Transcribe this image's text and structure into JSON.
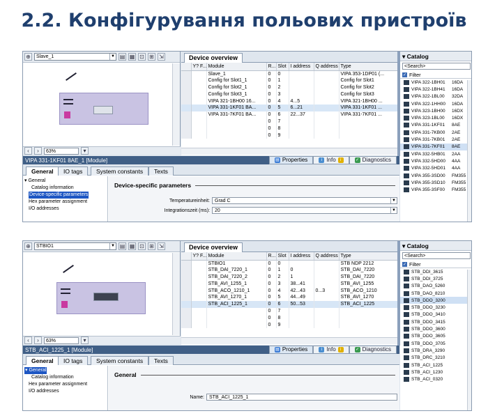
{
  "slide_title": "2.2. Конфігурування польових пристроїв",
  "panels": [
    {
      "device_combo": "Slave_1",
      "zoom": "63%",
      "overview_tab": "Device overview",
      "columns": [
        "",
        "Y? F...",
        "Module",
        "R...",
        "Slot",
        "I address",
        "Q address",
        "Type"
      ],
      "rows": [
        [
          "",
          "",
          "Slave_1",
          "0",
          "0",
          "",
          "",
          "VIPA 353-1DP01 (..."
        ],
        [
          "",
          "",
          "Config for Slot1_1",
          "0",
          "1",
          "",
          "",
          "Config for Slot1"
        ],
        [
          "",
          "",
          "Config for Slot2_1",
          "0",
          "2",
          "",
          "",
          "Config for Slot2"
        ],
        [
          "",
          "",
          "Config for Slot3_1",
          "0",
          "3",
          "",
          "",
          "Config for Slot3"
        ],
        [
          "",
          "",
          "VIPA 321-1BH00    16...",
          "0",
          "4",
          "4...5",
          "",
          "VIPA 321-1BH00 ..."
        ],
        [
          "",
          "",
          "VIPA 331-1KF01    BA...",
          "0",
          "5",
          "6...21",
          "",
          "VIPA 331-1KF01 ..."
        ],
        [
          "",
          "",
          "VIPA 331-7KF01    BA...",
          "0",
          "6",
          "22...37",
          "",
          "VIPA 331-7KF01 ..."
        ],
        [
          "",
          "",
          "",
          "0",
          "7",
          "",
          "",
          ""
        ],
        [
          "",
          "",
          "",
          "0",
          "8",
          "",
          "",
          ""
        ],
        [
          "",
          "",
          "",
          "0",
          "9",
          "",
          "",
          ""
        ]
      ],
      "selected_row": 5,
      "inspector_title": "VIPA 331-1KF01        8AE_1 [Module]",
      "tab_properties": "Properties",
      "tab_info": "Info",
      "tab_diagnostics": "Diagnostics",
      "subtabs": [
        "General",
        "IO tags",
        "System constants",
        "Texts"
      ],
      "tree": [
        "▾ General",
        "Catalog information",
        "Device-specific parameters",
        "Hex parameter assignment",
        "I/O addresses"
      ],
      "tree_selected": 2,
      "section_title": "Device-specific parameters",
      "fields": [
        {
          "label": "Temperatureinheit:",
          "value": "Grad C",
          "dropdown": true
        },
        {
          "label": "Integrationszeit (ms):",
          "value": "20",
          "dropdown": true
        }
      ],
      "catalog_title": "Catalog",
      "catalog_search": "<Search>",
      "catalog_filter": "Filter",
      "catalog_items": [
        [
          "VIPA 322-1BH01",
          "16DA"
        ],
        [
          "VIPA 322-1BH41",
          "16DA"
        ],
        [
          "VIPA 322-1BL00",
          "32DA"
        ],
        [
          "VIPA 322-1HH00",
          "16DA"
        ],
        [
          "VIPA 323-1BH00",
          "16DX"
        ],
        [
          "VIPA 323-1BL00",
          "16DX"
        ],
        [
          "VIPA 331-1KF01",
          "8AE"
        ],
        [
          "VIPA 331-7KB00",
          "2AE"
        ],
        [
          "VIPA 331-7KB01",
          "2AE"
        ],
        [
          "VIPA 331-7KF01",
          "8AE"
        ],
        [
          "VIPA 332-5HB01",
          "2AA"
        ],
        [
          "VIPA 332-5HD00",
          "4AA"
        ],
        [
          "VIPA 332-5HD01",
          "4AA"
        ],
        [
          "VIPA 355-3SD00",
          "FM355"
        ],
        [
          "VIPA 355-3SD10",
          "FM355"
        ],
        [
          "VIPA 355-3SF00",
          "FM355"
        ]
      ],
      "catalog_selected": 9
    },
    {
      "device_combo": "STBIO1",
      "zoom": "63%",
      "overview_tab": "Device overview",
      "columns": [
        "",
        "Y? F...",
        "Module",
        "R...",
        "Slot",
        "I address",
        "Q address",
        "Type"
      ],
      "rows": [
        [
          "",
          "",
          "STBIO1",
          "0",
          "0",
          "",
          "",
          "STB NDP 2212"
        ],
        [
          "",
          "",
          "STB_DAI_7220_1",
          "0",
          "1",
          "0",
          "",
          "STB_DAI_7220"
        ],
        [
          "",
          "",
          "STB_DAI_7220_2",
          "0",
          "2",
          "1",
          "",
          "STB_DAI_7220"
        ],
        [
          "",
          "",
          "STB_AVI_1255_1",
          "0",
          "3",
          "38...41",
          "",
          "STB_AVI_1255"
        ],
        [
          "",
          "",
          "STB_ACO_1210_1",
          "0",
          "4",
          "42...43",
          "0...3",
          "STB_ACO_1210"
        ],
        [
          "",
          "",
          "STB_AVI_1270_1",
          "0",
          "5",
          "44...49",
          "",
          "STB_AVI_1270"
        ],
        [
          "",
          "",
          "STB_ACI_1225_1",
          "0",
          "6",
          "50...53",
          "",
          "STB_ACI_1225"
        ],
        [
          "",
          "",
          "",
          "0",
          "7",
          "",
          "",
          ""
        ],
        [
          "",
          "",
          "",
          "0",
          "8",
          "",
          "",
          ""
        ],
        [
          "",
          "",
          "",
          "0",
          "9",
          "",
          "",
          ""
        ]
      ],
      "selected_row": 6,
      "inspector_title": "STB_ACI_1225_1 [Module]",
      "tab_properties": "Properties",
      "tab_info": "Info",
      "tab_diagnostics": "Diagnostics",
      "subtabs": [
        "General",
        "IO tags",
        "System constants",
        "Texts"
      ],
      "tree": [
        "▾ General",
        "Catalog information",
        "Hex parameter assignment",
        "I/O addresses"
      ],
      "tree_selected": 0,
      "section_title": "General",
      "fields": [
        {
          "label": "Name:",
          "value": "STB_ACI_1225_1",
          "dropdown": false
        }
      ],
      "catalog_title": "Catalog",
      "catalog_search": "<Search>",
      "catalog_filter": "Filter",
      "catalog_items": [
        [
          "STB_DDI_3615",
          ""
        ],
        [
          "STB_DDI_3725",
          ""
        ],
        [
          "STB_DAO_5260",
          ""
        ],
        [
          "STB_DAO_8210",
          ""
        ],
        [
          "STB_DDO_3200",
          ""
        ],
        [
          "STB_DDO_3230",
          ""
        ],
        [
          "STB_DDO_3410",
          ""
        ],
        [
          "STB_DDO_3415",
          ""
        ],
        [
          "STB_DDO_3600",
          ""
        ],
        [
          "STB_DDO_3605",
          ""
        ],
        [
          "STB_DDO_3705",
          ""
        ],
        [
          "STB_DRA_3290",
          ""
        ],
        [
          "STB_DRC_3210",
          ""
        ],
        [
          "STB_ACI_1225",
          ""
        ],
        [
          "STB_ACI_1230",
          ""
        ],
        [
          "STB_ACI_0320",
          ""
        ]
      ],
      "catalog_selected": 4
    }
  ]
}
